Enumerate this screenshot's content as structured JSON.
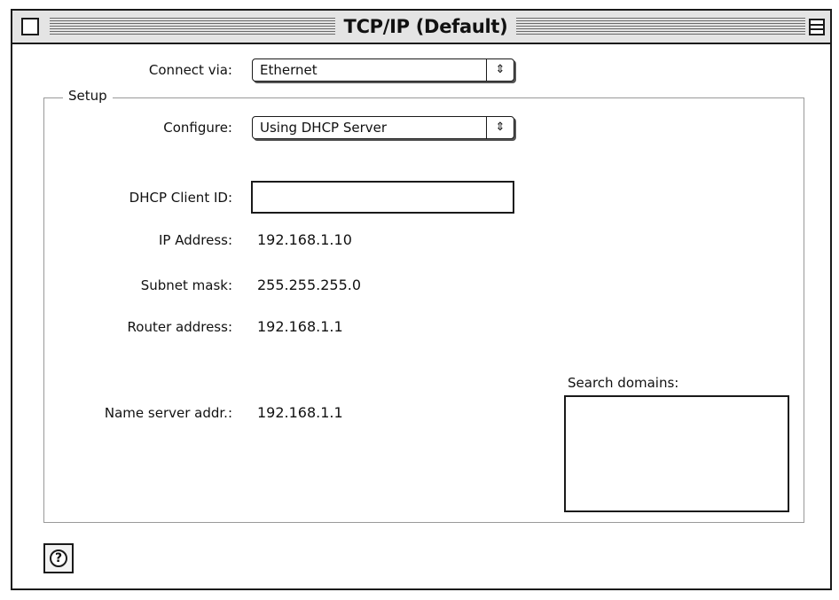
{
  "window": {
    "title": "TCP/IP (Default)"
  },
  "connect_via": {
    "label": "Connect via:",
    "selected": "Ethernet",
    "arrows_glyph": "⇕"
  },
  "setup": {
    "group_label": "Setup",
    "configure": {
      "label": "Configure:",
      "selected": "Using DHCP Server",
      "arrows_glyph": "⇕"
    },
    "dhcp_client_id": {
      "label": "DHCP Client ID:",
      "value": ""
    },
    "ip_address": {
      "label": "IP Address:",
      "value": "192.168.1.10"
    },
    "subnet_mask": {
      "label": "Subnet mask:",
      "value": "255.255.255.0"
    },
    "router_address": {
      "label": "Router address:",
      "value": "192.168.1.1"
    },
    "name_server": {
      "label": "Name server addr.:",
      "value": "192.168.1.1"
    },
    "search_domains": {
      "label": "Search domains:",
      "value": ""
    }
  },
  "help": {
    "glyph": "?"
  }
}
